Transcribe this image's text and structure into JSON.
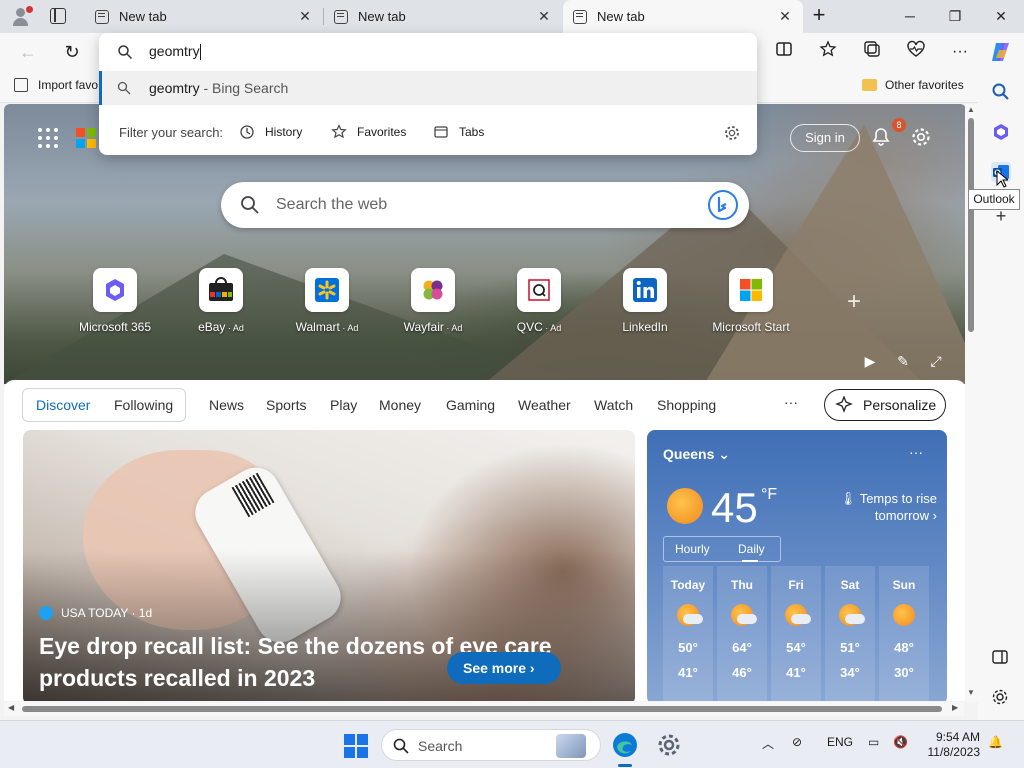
{
  "browser": {
    "tabs": [
      {
        "title": "New tab",
        "active": false
      },
      {
        "title": "New tab",
        "active": false
      },
      {
        "title": "New tab",
        "active": true
      }
    ],
    "window_controls": {
      "minimize": "─",
      "restore": "❐",
      "close": "✕"
    }
  },
  "address_dropdown": {
    "query": "geomtry",
    "suggestion": {
      "term": "geomtry",
      "source": " - Bing Search"
    },
    "filter_label": "Filter your search:",
    "filters": [
      "History",
      "Favorites",
      "Tabs"
    ]
  },
  "favorites_bar": {
    "import_label": "Import favo",
    "other_label": "Other favorites"
  },
  "sidebar": {
    "tooltip": "Outlook"
  },
  "newtab_page": {
    "sign_in": "Sign in",
    "notification_count": "8",
    "search_placeholder": "Search the web",
    "quick_links": [
      {
        "label": "Microsoft 365",
        "ad": ""
      },
      {
        "label": "eBay",
        "ad": " · Ad"
      },
      {
        "label": "Walmart",
        "ad": " · Ad"
      },
      {
        "label": "Wayfair",
        "ad": " · Ad"
      },
      {
        "label": "QVC",
        "ad": " · Ad"
      },
      {
        "label": "LinkedIn",
        "ad": ""
      },
      {
        "label": "Microsoft Start",
        "ad": ""
      }
    ]
  },
  "feed_nav": {
    "tabs": [
      "Discover",
      "Following",
      "News",
      "Sports",
      "Play",
      "Money",
      "Gaming",
      "Weather",
      "Watch",
      "Shopping"
    ],
    "active": "Discover",
    "more": "···",
    "personalize": "Personalize"
  },
  "article": {
    "source": "USA TODAY · 1d",
    "headline": "Eye drop recall list: See the dozens of eye care products recalled in 2023",
    "see_more": "See more"
  },
  "weather": {
    "city": "Queens",
    "more": "···",
    "temp": "45",
    "unit": "°F",
    "note": "Temps to rise tomorrow",
    "toggle": [
      "Hourly",
      "Daily"
    ],
    "selected": "Daily",
    "days": [
      {
        "name": "Today",
        "hi": "50°",
        "lo": "41°",
        "icon": "partly-sunny"
      },
      {
        "name": "Thu",
        "hi": "64°",
        "lo": "46°",
        "icon": "partly-cloudy"
      },
      {
        "name": "Fri",
        "hi": "54°",
        "lo": "41°",
        "icon": "partly-cloudy"
      },
      {
        "name": "Sat",
        "hi": "51°",
        "lo": "34°",
        "icon": "partly-sunny"
      },
      {
        "name": "Sun",
        "hi": "48°",
        "lo": "30°",
        "icon": "sunny"
      }
    ]
  },
  "taskbar": {
    "search_label": "Search",
    "language": "ENG",
    "time": "9:54 AM",
    "date": "11/8/2023"
  },
  "colors": {
    "accent": "#0f6cbd",
    "weather_bg": "#4f7cbf",
    "badge": "#d9532c"
  }
}
